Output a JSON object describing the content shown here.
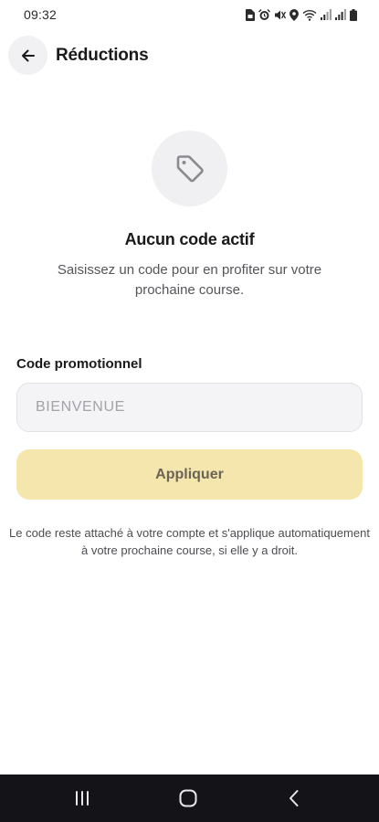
{
  "status_bar": {
    "time": "09:32",
    "icons": [
      "sim-icon",
      "alarm-icon",
      "mute-icon",
      "location-icon",
      "wifi-icon",
      "signal-icon",
      "signal-icon",
      "battery-icon"
    ]
  },
  "header": {
    "back_icon": "arrow-left-icon",
    "title": "Réductions"
  },
  "empty_state": {
    "icon": "tag-icon",
    "title": "Aucun code actif",
    "subtitle": "Saisissez un code pour en profiter sur votre prochaine course."
  },
  "promo_form": {
    "label": "Code promotionnel",
    "input_value": "",
    "input_placeholder": "BIENVENUE",
    "apply_label": "Appliquer"
  },
  "info_text": "Le code reste attaché à votre compte et s'applique automatiquement à votre prochaine course, si elle y a droit.",
  "nav_bar": {
    "buttons": [
      "recent-apps-icon",
      "home-icon",
      "back-icon"
    ]
  },
  "colors": {
    "apply_button_bg": "#f5e6ad",
    "apply_button_text": "#6b6456",
    "input_bg": "#f4f4f6",
    "nav_bar_bg": "#141418"
  }
}
